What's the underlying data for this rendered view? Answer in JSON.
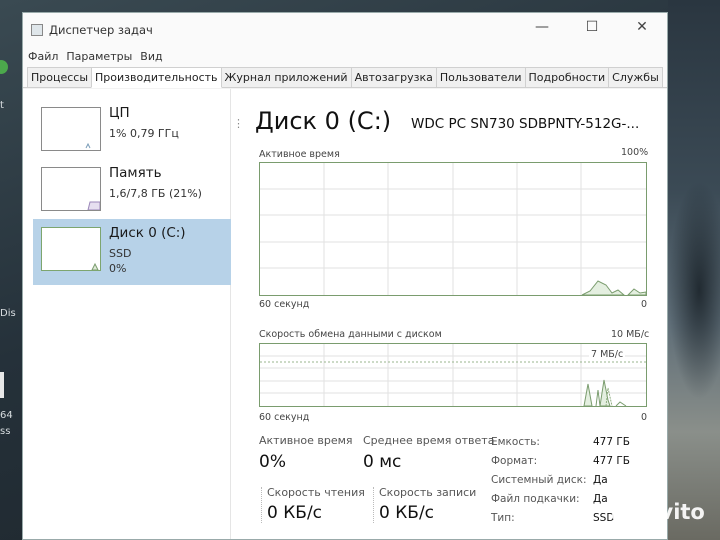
{
  "window": {
    "title": "Диспетчер задач",
    "controls": {
      "minimize": "—",
      "maximize": "☐",
      "close": "✕"
    }
  },
  "menu": {
    "items": [
      "Файл",
      "Параметры",
      "Вид"
    ]
  },
  "tabs": [
    "Процессы",
    "Производительность",
    "Журнал приложений",
    "Автозагрузка",
    "Пользователи",
    "Подробности",
    "Службы"
  ],
  "active_tab": "Производительность",
  "sidebar": {
    "items": [
      {
        "name": "ЦП",
        "sub1": "1% 0,79 ГГц",
        "sub2": ""
      },
      {
        "name": "Память",
        "sub1": "1,6/7,8 ГБ (21%)",
        "sub2": ""
      },
      {
        "name": "Диск 0 (C:)",
        "sub1": "SSD",
        "sub2": "0%"
      }
    ],
    "selected": "Диск 0 (C:)"
  },
  "detail": {
    "title": "Диск 0 (C:)",
    "model": "WDC PC SN730 SDBPNTY-512G-...",
    "graph1": {
      "label": "Активное время",
      "max_label": "100%",
      "time_label": "60 секунд",
      "min_label": "0"
    },
    "graph2": {
      "label": "Скорость обмена данными с диском",
      "max_label": "10 МБ/с",
      "inner_label": "7 МБ/с",
      "time_label": "60 секунд",
      "min_label": "0"
    },
    "stats": {
      "active_time_label": "Активное время",
      "active_time_value": "0%",
      "avg_response_label": "Среднее время ответа",
      "avg_response_value": "0 мс",
      "read_speed_label": "Скорость чтения",
      "read_speed_value": "0 КБ/с",
      "write_speed_label": "Скорость записи",
      "write_speed_value": "0 КБ/с"
    },
    "info": [
      {
        "key": "Емкость:",
        "value": "477 ГБ"
      },
      {
        "key": "Формат:",
        "value": "477 ГБ"
      },
      {
        "key": "Системный диск:",
        "value": "Да"
      },
      {
        "key": "Файл подкачки:",
        "value": "Да"
      },
      {
        "key": "Тип:",
        "value": "SSD"
      }
    ]
  },
  "desktop": {
    "texts": [
      "t",
      "Dis",
      "64",
      "ss"
    ]
  },
  "watermark": {
    "text": "Avito"
  },
  "colors": {
    "graph_border": "#7a9c6e",
    "graph_fill": "#e4efe0",
    "selected_item": "#b7d2e8"
  }
}
